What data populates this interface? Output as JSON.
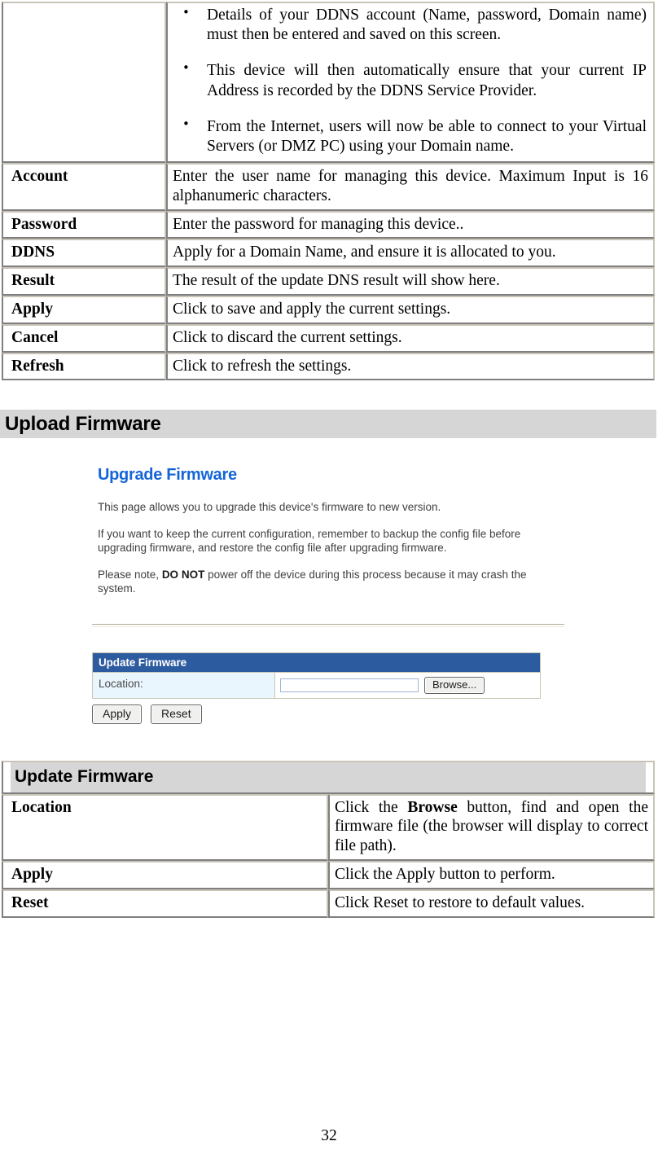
{
  "ddns_table": {
    "intro_bullets": [
      "Details of your DDNS account (Name, password, Domain name) must then be entered and saved on this screen.",
      "This device will then automatically ensure that your current IP Address is recorded by the DDNS Service Provider.",
      "From the Internet, users will now be able to connect to your Virtual Servers (or DMZ PC) using your Domain name."
    ],
    "rows": [
      {
        "label": "Account",
        "desc": "Enter the user name for managing this device. Maximum Input is 16 alphanumeric characters."
      },
      {
        "label": "Password",
        "desc": "Enter the password for managing this device.."
      },
      {
        "label": "DDNS",
        "desc": "Apply for a Domain Name, and ensure it is allocated to you."
      },
      {
        "label": "Result",
        "desc": "The result of the update DNS result will show here."
      },
      {
        "label": "Apply",
        "desc": "Click to save and apply the current settings."
      },
      {
        "label": "Cancel",
        "desc": "Click to discard the current settings."
      },
      {
        "label": "Refresh",
        "desc": "Click to refresh the settings."
      }
    ]
  },
  "section": {
    "heading": "Upload Firmware"
  },
  "screenshot": {
    "heading": "Upgrade Firmware",
    "para1": "This page allows you to upgrade this device's firmware to new version.",
    "para2": "If you want to keep the current configuration, remember to backup the config file before upgrading firmware, and restore the config file after upgrading firmware.",
    "para3_pre": "Please note, ",
    "para3_bold": "DO NOT",
    "para3_post": " power off the device during this process because it may crash the system.",
    "panel": {
      "title": "Update Firmware",
      "location_label": "Location:",
      "location_value": "",
      "location_placeholder": "",
      "browse_label": "Browse...",
      "apply_label": "Apply",
      "reset_label": "Reset"
    }
  },
  "firmware_table": {
    "header": "Update Firmware",
    "rows": [
      {
        "label": "Location",
        "desc_pre": "Click the ",
        "desc_bold": "Browse",
        "desc_post": " button, find and open the firmware file (the browser will display to correct file path)."
      },
      {
        "label": "Apply",
        "desc_pre": "Click the Apply button to perform.",
        "desc_bold": "",
        "desc_post": ""
      },
      {
        "label": "Reset",
        "desc_pre": "Click Reset to restore to default values.",
        "desc_bold": "",
        "desc_post": ""
      }
    ]
  },
  "footer": {
    "page_number": "32"
  },
  "colors": {
    "section_bar": "#d6d6d6",
    "panel_header_blue": "#2d5ba0",
    "panel_cell_blue": "#eaf6fd",
    "screenshot_heading_blue": "#1565d8",
    "table_border_dark": "#7f7f7f",
    "table_border_light": "#c8c4b8"
  }
}
